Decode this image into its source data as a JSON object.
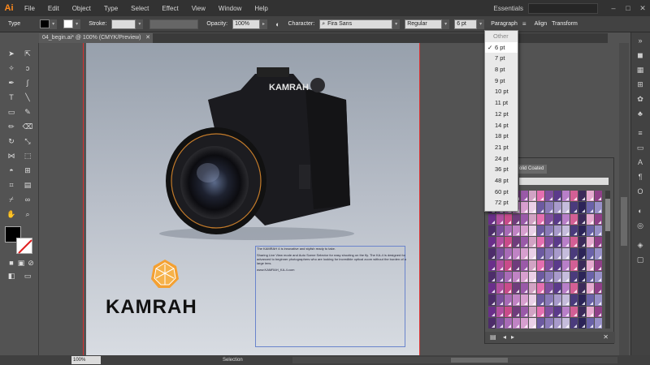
{
  "app": {
    "logo": "Ai"
  },
  "menu": [
    "File",
    "Edit",
    "Object",
    "Type",
    "Select",
    "Effect",
    "View",
    "Window",
    "Help"
  ],
  "workspace": "Essentials",
  "options": {
    "tool_label": "Type",
    "stroke_label": "Stroke:",
    "opacity_label": "Opacity:",
    "opacity_value": "100%",
    "character_label": "Character:",
    "font": "Fira Sans",
    "style": "Regular",
    "size": "6 pt",
    "paragraph_label": "Paragraph",
    "align_label": "Align",
    "transform_label": "Transform"
  },
  "document": {
    "tab_label": "04_begin.ai* @ 100% (CMYK/Preview)"
  },
  "artwork": {
    "camera_brand": "KAMRAH",
    "logo_text": "KAMRAH",
    "body_lines": [
      "The KAMRAH 4 is innovative and stylish ready to take.",
      "Sharing Live View mode and Auto Scene Selector for easy shooting on the fly. The KA-4 is designed for",
      "advanced to beginner photographers who are looking for incredible optical zoom without the burden of a",
      "large lens.",
      "www.KAMRAH_KA-4.com"
    ]
  },
  "size_menu": {
    "header": "Other",
    "items": [
      "6 pt",
      "7 pt",
      "8 pt",
      "9 pt",
      "10 pt",
      "11 pt",
      "12 pt",
      "14 pt",
      "18 pt",
      "21 pt",
      "24 pt",
      "36 pt",
      "48 pt",
      "60 pt",
      "72 pt"
    ],
    "selected": "6 pt"
  },
  "swatch_panel": {
    "tab_label": "olid Coated",
    "colors": [
      "#6a2f8a",
      "#b14fa0",
      "#c94b8a",
      "#6f3c7c",
      "#9a5aa8",
      "#d2a3c4",
      "#e46fb0",
      "#7f4f9f",
      "#5b3a8b",
      "#b87fc8",
      "#d35f95",
      "#3c2a5a",
      "#e5a9cf",
      "#8f3f88",
      "#4d2d6a",
      "#7a4f9c",
      "#a86bb6",
      "#c083c4",
      "#d79fcf",
      "#ead0e7",
      "#6c5aa0",
      "#8a7ab8",
      "#a89acb",
      "#c5bcdc",
      "#4a3b7c",
      "#2c2458",
      "#6a62a8",
      "#9890c8"
    ]
  },
  "status": {
    "zoom": "100%",
    "mode": "Selection"
  }
}
